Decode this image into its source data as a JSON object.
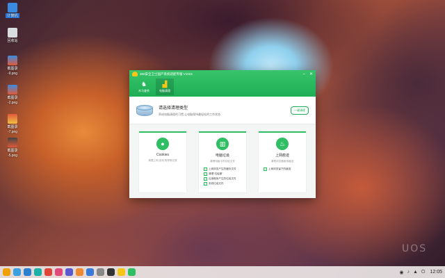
{
  "desktop": {
    "watermark": "UOS",
    "icons": [
      {
        "label": "计算机",
        "icon": "computer-icon",
        "selected": true
      },
      {
        "label": "回收站",
        "icon": "trash-icon",
        "selected": false
      },
      {
        "label": "截图录",
        "icon": "image-icon",
        "selected": false
      },
      {
        "label": "-9.png",
        "icon": "image-icon",
        "selected": false
      },
      {
        "label": "截图录",
        "icon": "image-icon",
        "selected": false
      },
      {
        "label": "-2.png",
        "icon": "image-icon",
        "selected": false
      },
      {
        "label": "截图录",
        "icon": "image-icon",
        "selected": false
      },
      {
        "label": "-7.png",
        "icon": "image-icon",
        "selected": false
      },
      {
        "label": "截图录",
        "icon": "image-icon",
        "selected": false
      },
      {
        "label": "-5.png",
        "icon": "image-icon",
        "selected": false
      }
    ]
  },
  "app": {
    "title": "360安全卫士国产系统适配专版 V1024",
    "tabs": [
      {
        "label": "木马查杀",
        "icon": "horse-icon",
        "active": false
      },
      {
        "label": "电脑清理",
        "icon": "broom-icon",
        "active": true
      }
    ],
    "banner": {
      "title": "请选择清理类型",
      "subtitle": "养成电脑清理的习惯,让电脑保持最轻松的工作状态",
      "button": "一键清理"
    },
    "cards": [
      {
        "title": "Cookies",
        "desc": "清理上网,游戏,购物等记录",
        "icon": "cookie-icon",
        "checks": []
      },
      {
        "title": "电脑垃圾",
        "desc": "清理电脑中的垃圾文件",
        "icon": "trash-bin-icon",
        "checks": [
          "上网浏览产生的缓存文件",
          "清理\"垃圾篓\"",
          "应用程序产生的垃圾文件",
          "系统垃圾文件"
        ]
      },
      {
        "title": "上网痕迹",
        "desc": "清理浏览器使用痕迹",
        "icon": "footprint-icon",
        "checks": [
          "上网浏览留下的痕迹"
        ]
      }
    ]
  },
  "taskbar": {
    "clock": "12:05",
    "apps": [
      "launcher-icon",
      "multitask-icon",
      "files-icon",
      "browser-icon",
      "store-icon",
      "music-icon",
      "video-icon",
      "photos-icon",
      "mail-icon",
      "settings-icon",
      "terminal-icon",
      "app-360-icon",
      "security-icon"
    ],
    "app_colors": [
      "#f0a000",
      "#3aa0e0",
      "#2d7fd0",
      "#1bb0a8",
      "#e0453a",
      "#e04a7a",
      "#5a5ad0",
      "#f08a30",
      "#3a7ad8",
      "#888888",
      "#333333",
      "#f5c518",
      "#2fbe63"
    ]
  }
}
